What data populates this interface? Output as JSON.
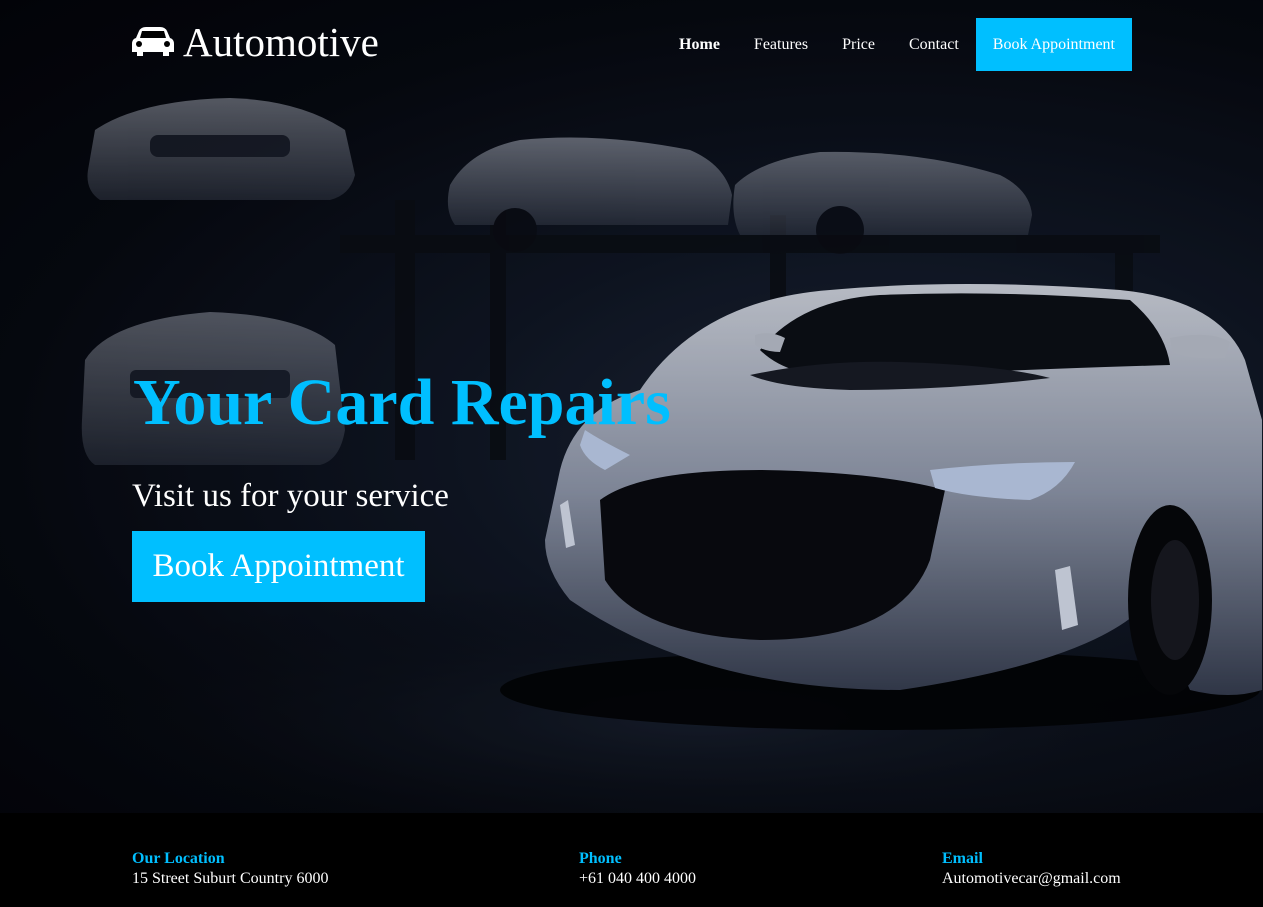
{
  "brand": {
    "name": "Automotive",
    "icon": "car-icon"
  },
  "nav": {
    "items": [
      {
        "label": "Home",
        "active": true
      },
      {
        "label": "Features",
        "active": false
      },
      {
        "label": "Price",
        "active": false
      },
      {
        "label": "Contact",
        "active": false
      }
    ],
    "cta_label": "Book Appointment"
  },
  "hero": {
    "title": "Your Card Repairs",
    "subtitle": "Visit us for your service",
    "button_label": "Book Appointment"
  },
  "footer": {
    "location": {
      "title": "Our Location",
      "value": "15 Street Suburt Country 6000"
    },
    "phone": {
      "title": "Phone",
      "value": "+61 040 400 4000"
    },
    "email": {
      "title": "Email",
      "value": "Automotivecar@gmail.com"
    }
  },
  "colors": {
    "accent": "#00bfff",
    "background": "#000000",
    "text": "#ffffff"
  }
}
